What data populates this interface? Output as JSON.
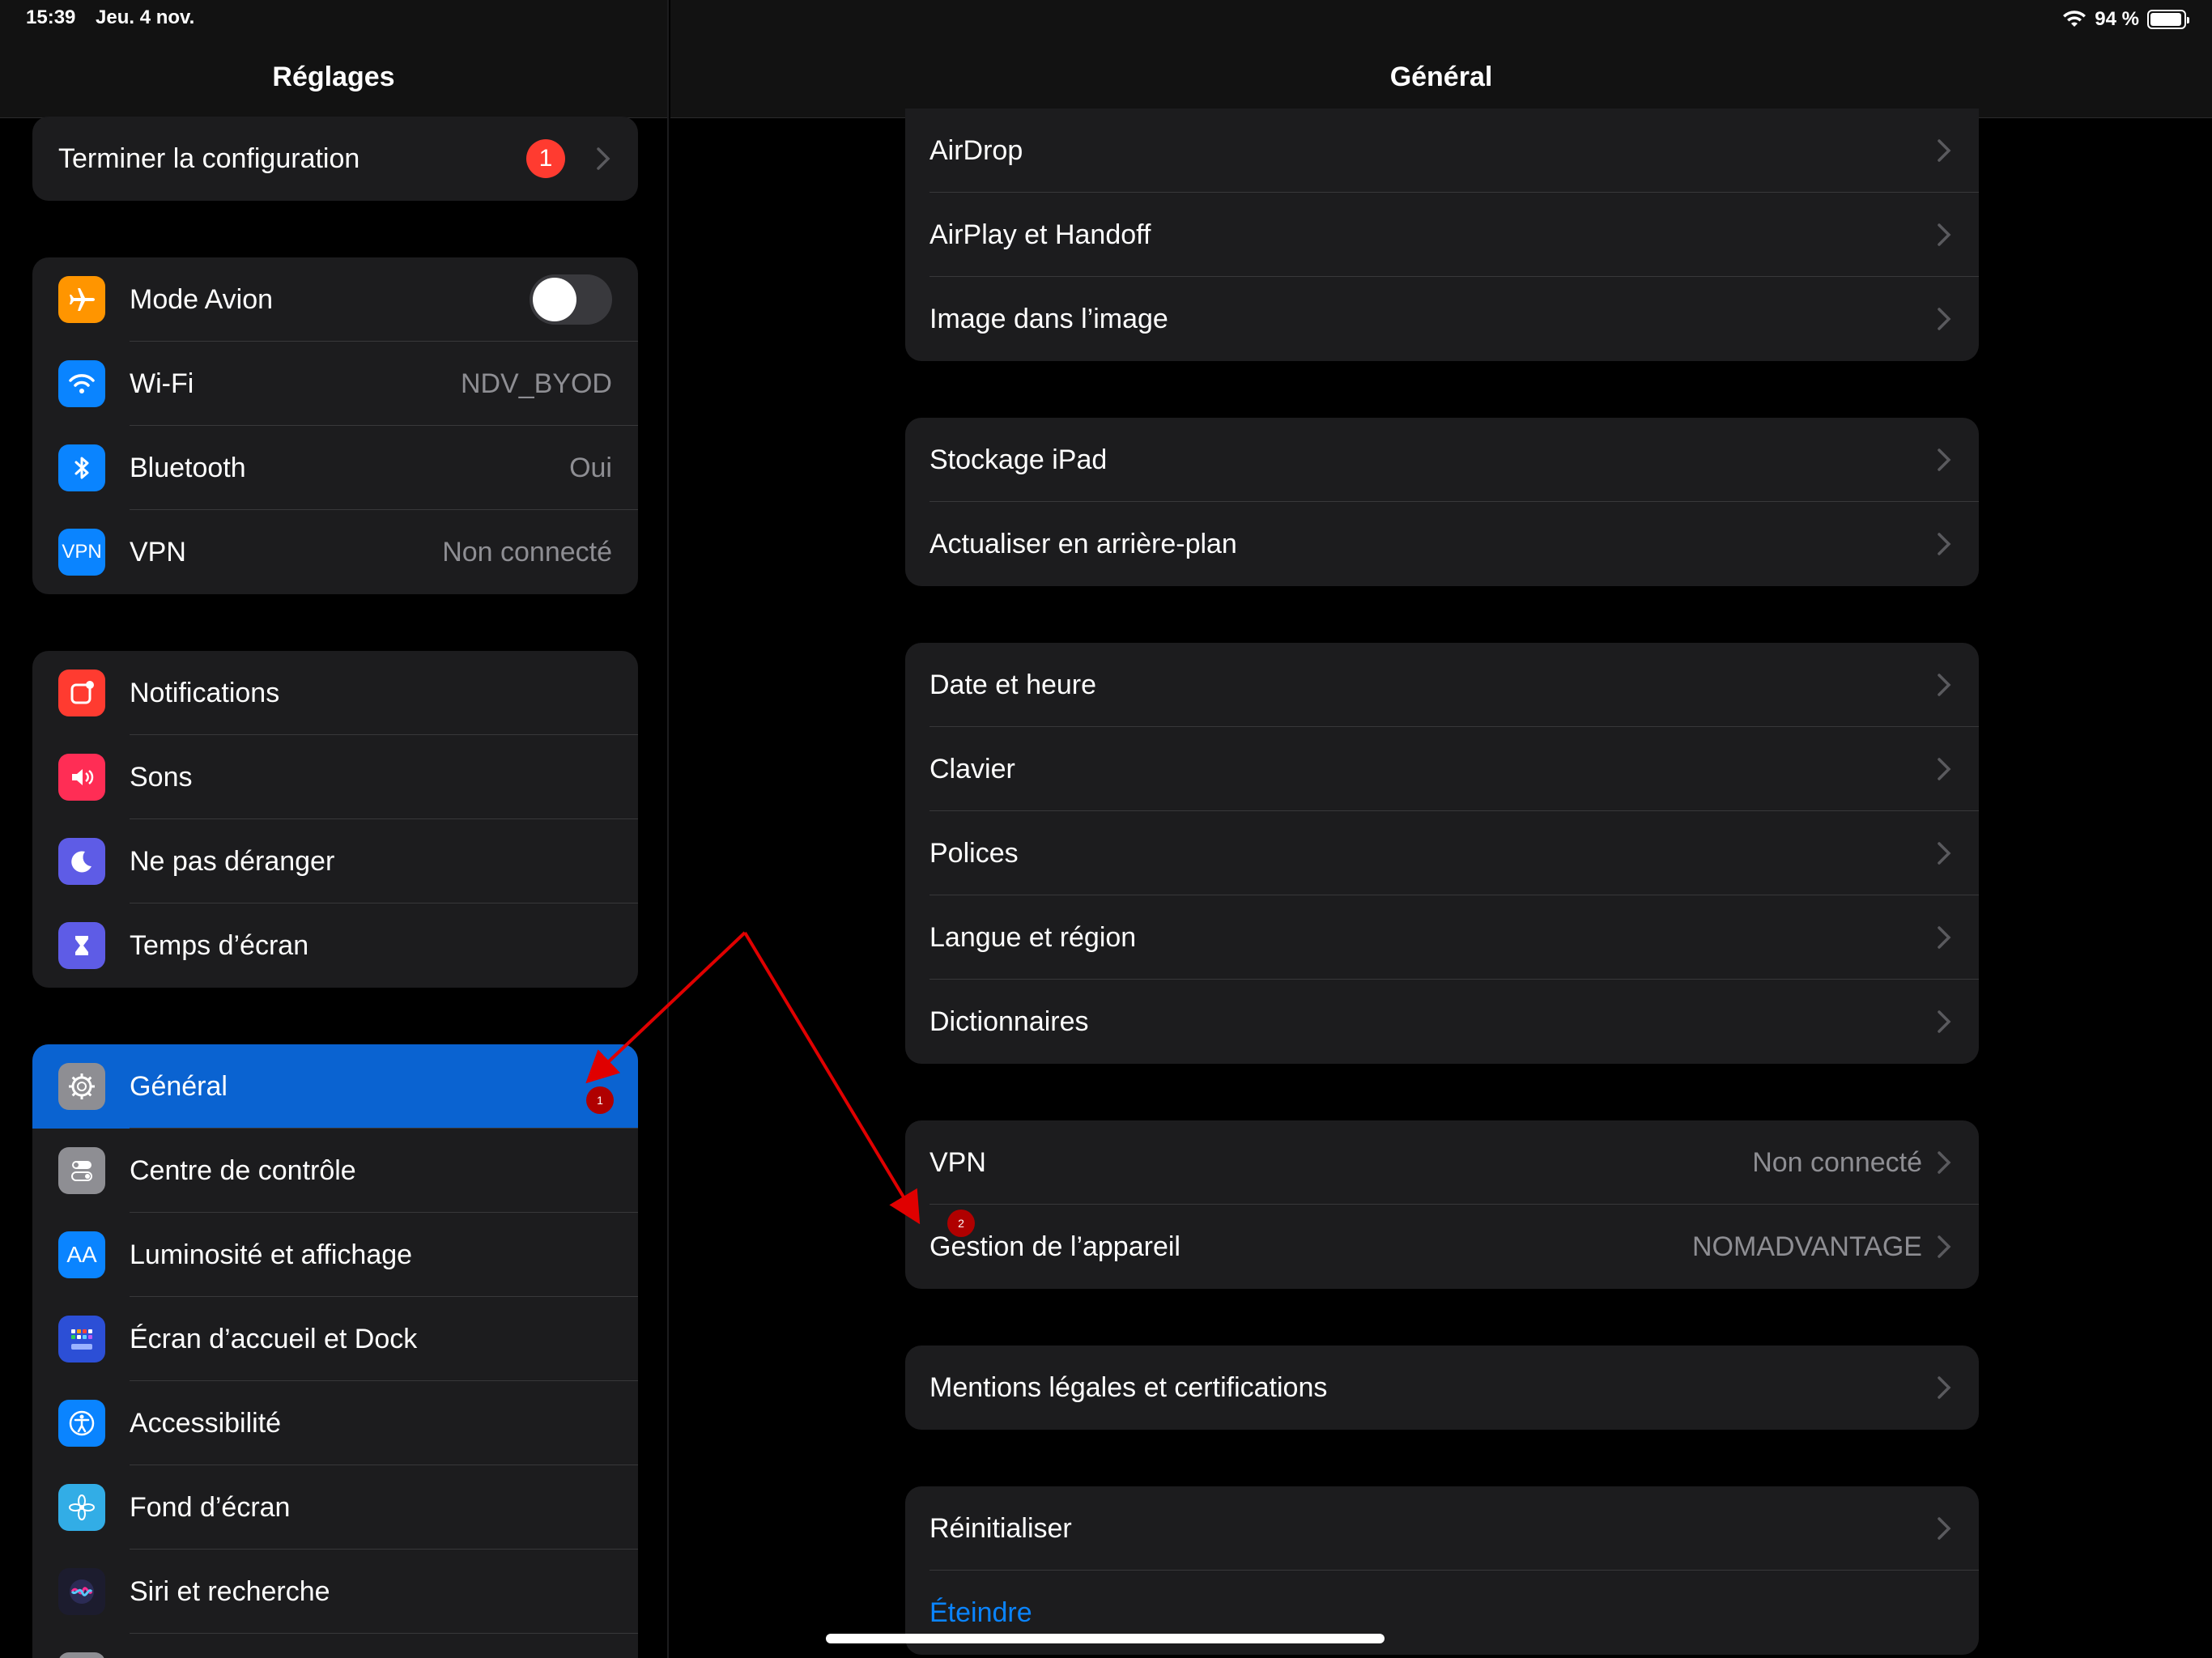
{
  "status_bar": {
    "time": "15:39",
    "date": "Jeu. 4 nov.",
    "battery_text": "94 %",
    "battery_level": 0.94
  },
  "sidebar": {
    "title": "Réglages",
    "setup": {
      "label": "Terminer la configuration",
      "badge": "1"
    },
    "network": [
      {
        "name": "airplane",
        "label": "Mode Avion",
        "value": "",
        "toggle": false
      },
      {
        "name": "wifi",
        "label": "Wi-Fi",
        "value": "NDV_BYOD"
      },
      {
        "name": "bluetooth",
        "label": "Bluetooth",
        "value": "Oui"
      },
      {
        "name": "vpn",
        "label": "VPN",
        "value": "Non connecté",
        "icon_text": "VPN"
      }
    ],
    "alerts": [
      {
        "name": "notifications",
        "label": "Notifications"
      },
      {
        "name": "sounds",
        "label": "Sons"
      },
      {
        "name": "do-not-disturb",
        "label": "Ne pas déranger"
      },
      {
        "name": "screen-time",
        "label": "Temps d’écran"
      }
    ],
    "system": [
      {
        "name": "general",
        "label": "Général",
        "selected": true
      },
      {
        "name": "control-center",
        "label": "Centre de contrôle"
      },
      {
        "name": "display",
        "label": "Luminosité et affichage",
        "icon_text": "AA"
      },
      {
        "name": "home-screen",
        "label": "Écran d’accueil et Dock"
      },
      {
        "name": "accessibility",
        "label": "Accessibilité"
      },
      {
        "name": "wallpaper",
        "label": "Fond d’écran"
      },
      {
        "name": "siri",
        "label": "Siri et recherche"
      }
    ]
  },
  "detail": {
    "title": "Général",
    "group1": [
      {
        "label": "AirDrop"
      },
      {
        "label": "AirPlay et Handoff"
      },
      {
        "label": "Image dans l’image"
      }
    ],
    "group2": [
      {
        "label": "Stockage iPad"
      },
      {
        "label": "Actualiser en arrière-plan"
      }
    ],
    "group3": [
      {
        "label": "Date et heure"
      },
      {
        "label": "Clavier"
      },
      {
        "label": "Polices"
      },
      {
        "label": "Langue et région"
      },
      {
        "label": "Dictionnaires"
      }
    ],
    "group4": [
      {
        "label": "VPN",
        "value": "Non connecté"
      },
      {
        "label": "Gestion de l’appareil",
        "value": "NOMADVANTAGE"
      }
    ],
    "group5": [
      {
        "label": "Mentions légales et certifications"
      }
    ],
    "group6": [
      {
        "label": "Réinitialiser"
      },
      {
        "label": "Éteindre"
      }
    ]
  },
  "annotations": {
    "step1": "1",
    "step2": "2",
    "arrow_color": "#e00000"
  },
  "colors": {
    "accent": "#0a84ff",
    "selected_row": "#0a63d1",
    "group_bg": "#1c1c1e",
    "badge": "#ff3b30"
  }
}
